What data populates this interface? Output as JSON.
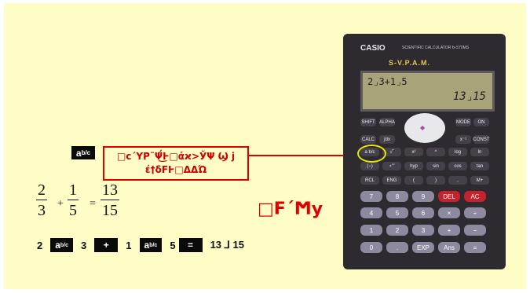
{
  "colors": {
    "background": "#fffdc6",
    "callout": "#e10000",
    "key": "#0a0a0a"
  },
  "abc_key": {
    "a": "a",
    "sup": "b/c"
  },
  "callout": {
    "line1": "□c´ΥP¨Ψ̈́͜Ͱ□άϰ>ЎΨ Ϣ j",
    "line2": "έ†δϜͰ□ΔΔΏ"
  },
  "fractions": [
    {
      "num": "2",
      "den": "3"
    },
    {
      "num": "1",
      "den": "5"
    },
    {
      "num": "13",
      "den": "15"
    }
  ],
  "operators": {
    "plus": "+",
    "equals": "="
  },
  "verdict": "□Ϝ´Ϻy",
  "sequence": {
    "t1": "2",
    "t2": "3",
    "plus": "+",
    "t3": "1",
    "t4": "5",
    "eq": "=",
    "result": "13 ⅃ 15"
  },
  "calculator": {
    "brand": "CASIO",
    "model": "SCIENTIFIC CALCULATOR fx-570MS",
    "label": "S-V.P.A.M.",
    "display_line1": "2⌟3+1⌟5",
    "display_line2": "13⌟15",
    "keys": [
      "SHIFT",
      "ALPHA",
      "MODE",
      "ON",
      "CALC",
      "∫dx",
      "x⁻¹",
      "CONST",
      "a b/c",
      "√‾",
      "x²",
      "^",
      "log",
      "ln",
      "(−)",
      "∘'\"",
      "hyp",
      "sin",
      "cos",
      "tan",
      "RCL",
      "ENG",
      "(",
      ")",
      ",",
      "M+",
      "7",
      "8",
      "9",
      "DEL",
      "AC",
      "4",
      "5",
      "6",
      "×",
      "÷",
      "1",
      "2",
      "3",
      "+",
      "−",
      "0",
      ".",
      "EXP",
      "Ans",
      "="
    ]
  }
}
